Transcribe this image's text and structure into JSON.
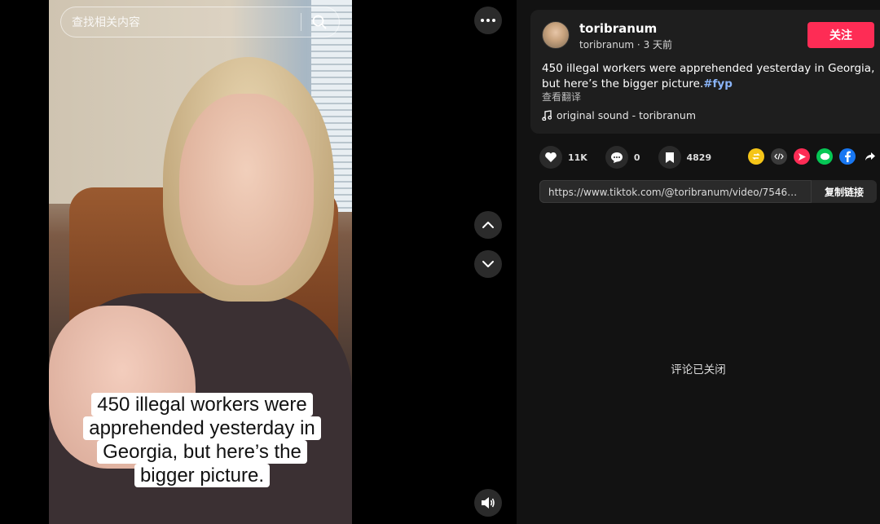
{
  "search": {
    "placeholder": "查找相关内容"
  },
  "video": {
    "caption_lines": [
      "450 illegal workers were",
      "apprehended yesterday in",
      "Georgia, but here’s the",
      "bigger picture."
    ]
  },
  "post": {
    "username": "toribranum",
    "meta": "toribranum · 3 天前",
    "follow_label": "关注",
    "description": "450 illegal workers were apprehended yesterday in Georgia, but here’s the bigger picture.",
    "hashtag": "#fyp",
    "translate_label": "查看翻译",
    "sound": "original sound - toribranum"
  },
  "stats": {
    "likes": "11K",
    "comments": "0",
    "saves": "4829"
  },
  "share": {
    "url": "https://www.tiktok.com/@toribranum/video/754660575...",
    "copy_label": "复制链接"
  },
  "comments": {
    "closed_text": "评论已关闭"
  },
  "colors": {
    "accent": "#fe2c55",
    "hashtag": "#8ab4f8"
  }
}
